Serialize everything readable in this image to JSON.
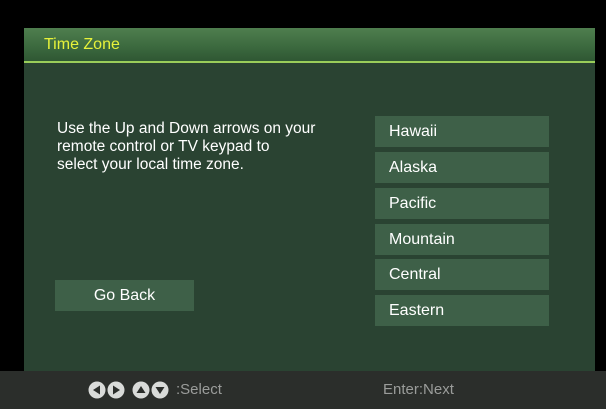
{
  "title": "Time Zone",
  "instructions": "Use the Up and Down arrows on your\nremote control or TV keypad to\nselect your local time zone.",
  "go_back_label": "Go Back",
  "time_zones": [
    "Hawaii",
    "Alaska",
    "Pacific",
    "Mountain",
    "Central",
    "Eastern"
  ],
  "footer": {
    "arrow_icons": [
      "left-arrow-icon",
      "right-arrow-icon",
      "up-arrow-icon",
      "down-arrow-icon"
    ],
    "select_label": ":Select",
    "next_label": "Enter:Next"
  },
  "colors": {
    "title_text": "#e7f23a",
    "title_underline": "#9acd5a",
    "panel_background": "#2a4332",
    "button_background": "#3e6048",
    "footer_text": "#9a9c9a"
  }
}
